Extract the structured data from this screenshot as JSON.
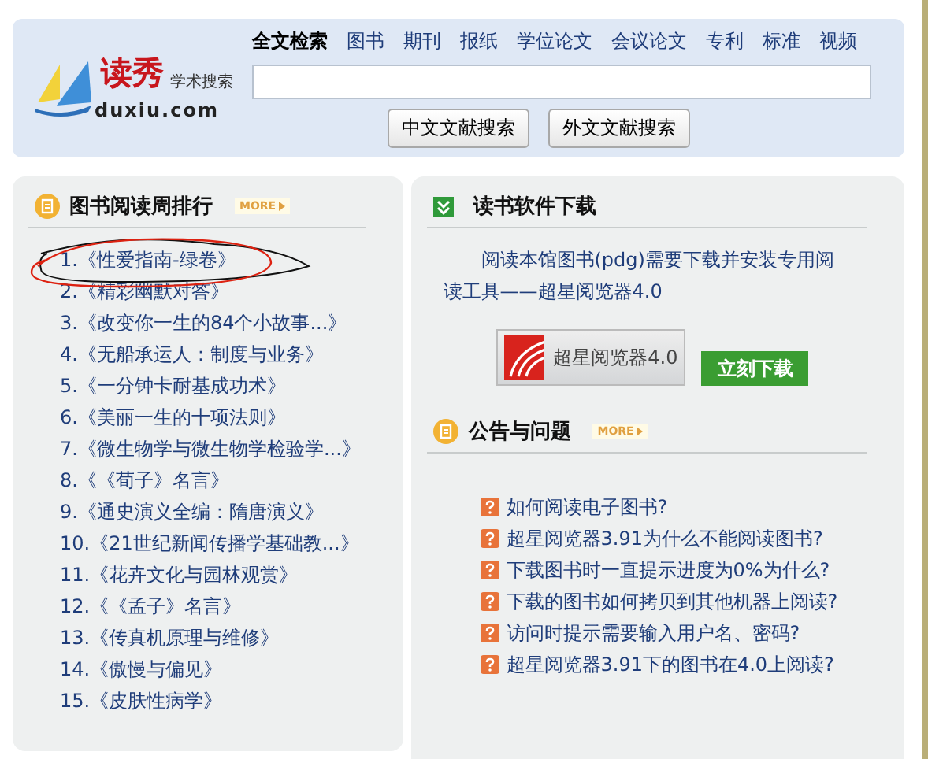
{
  "header": {
    "logo": {
      "name": "读秀",
      "subtitle": "学术搜索",
      "domain": "duxiu.com"
    },
    "search_tabs": [
      {
        "label": "全文检索",
        "selected": true
      },
      {
        "label": "图书",
        "selected": false
      },
      {
        "label": "期刊",
        "selected": false
      },
      {
        "label": "报纸",
        "selected": false
      },
      {
        "label": "学位论文",
        "selected": false
      },
      {
        "label": "会议论文",
        "selected": false
      },
      {
        "label": "专利",
        "selected": false
      },
      {
        "label": "标准",
        "selected": false
      },
      {
        "label": "视频",
        "selected": false
      }
    ],
    "buttons": [
      "中文文献搜索",
      "外文文献搜索"
    ]
  },
  "ranking": {
    "title": "图书阅读周排行",
    "more": "MORE",
    "books": [
      "1.《性爱指南-绿卷》",
      "2.《精彩幽默对答》",
      "3.《改变你一生的84个小故事...》",
      "4.《无船承运人：制度与业务》",
      "5.《一分钟卡耐基成功术》",
      "6.《美丽一生的十项法则》",
      "7.《微生物学与微生物学检验学...》",
      "8.《《荀子》名言》",
      "9.《通史演义全编：隋唐演义》",
      "10.《21世纪新闻传播学基础教...》",
      "11.《花卉文化与园林观赏》",
      "12.《《孟子》名言》",
      "13.《传真机原理与维修》",
      "14.《傲慢与偏见》",
      "15.《皮肤性病学》"
    ]
  },
  "download": {
    "title": "读书软件下载",
    "description": "阅读本馆图书(pdg)需要下载并安装专用阅读工具——超星阅览器4.0",
    "reader_label": "超星阅览器4.0",
    "button": "立刻下载"
  },
  "notices": {
    "title": "公告与问题",
    "more": "MORE",
    "items": [
      "如何阅读电子图书?",
      "超星阅览器3.91为什么不能阅读图书?",
      "下载图书时一直提示进度为0%为什么?",
      "下载的图书如何拷贝到其他机器上阅读?",
      "访问时提示需要输入用户名、密码?",
      "超星阅览器3.91下的图书在4.0上阅读?"
    ]
  }
}
